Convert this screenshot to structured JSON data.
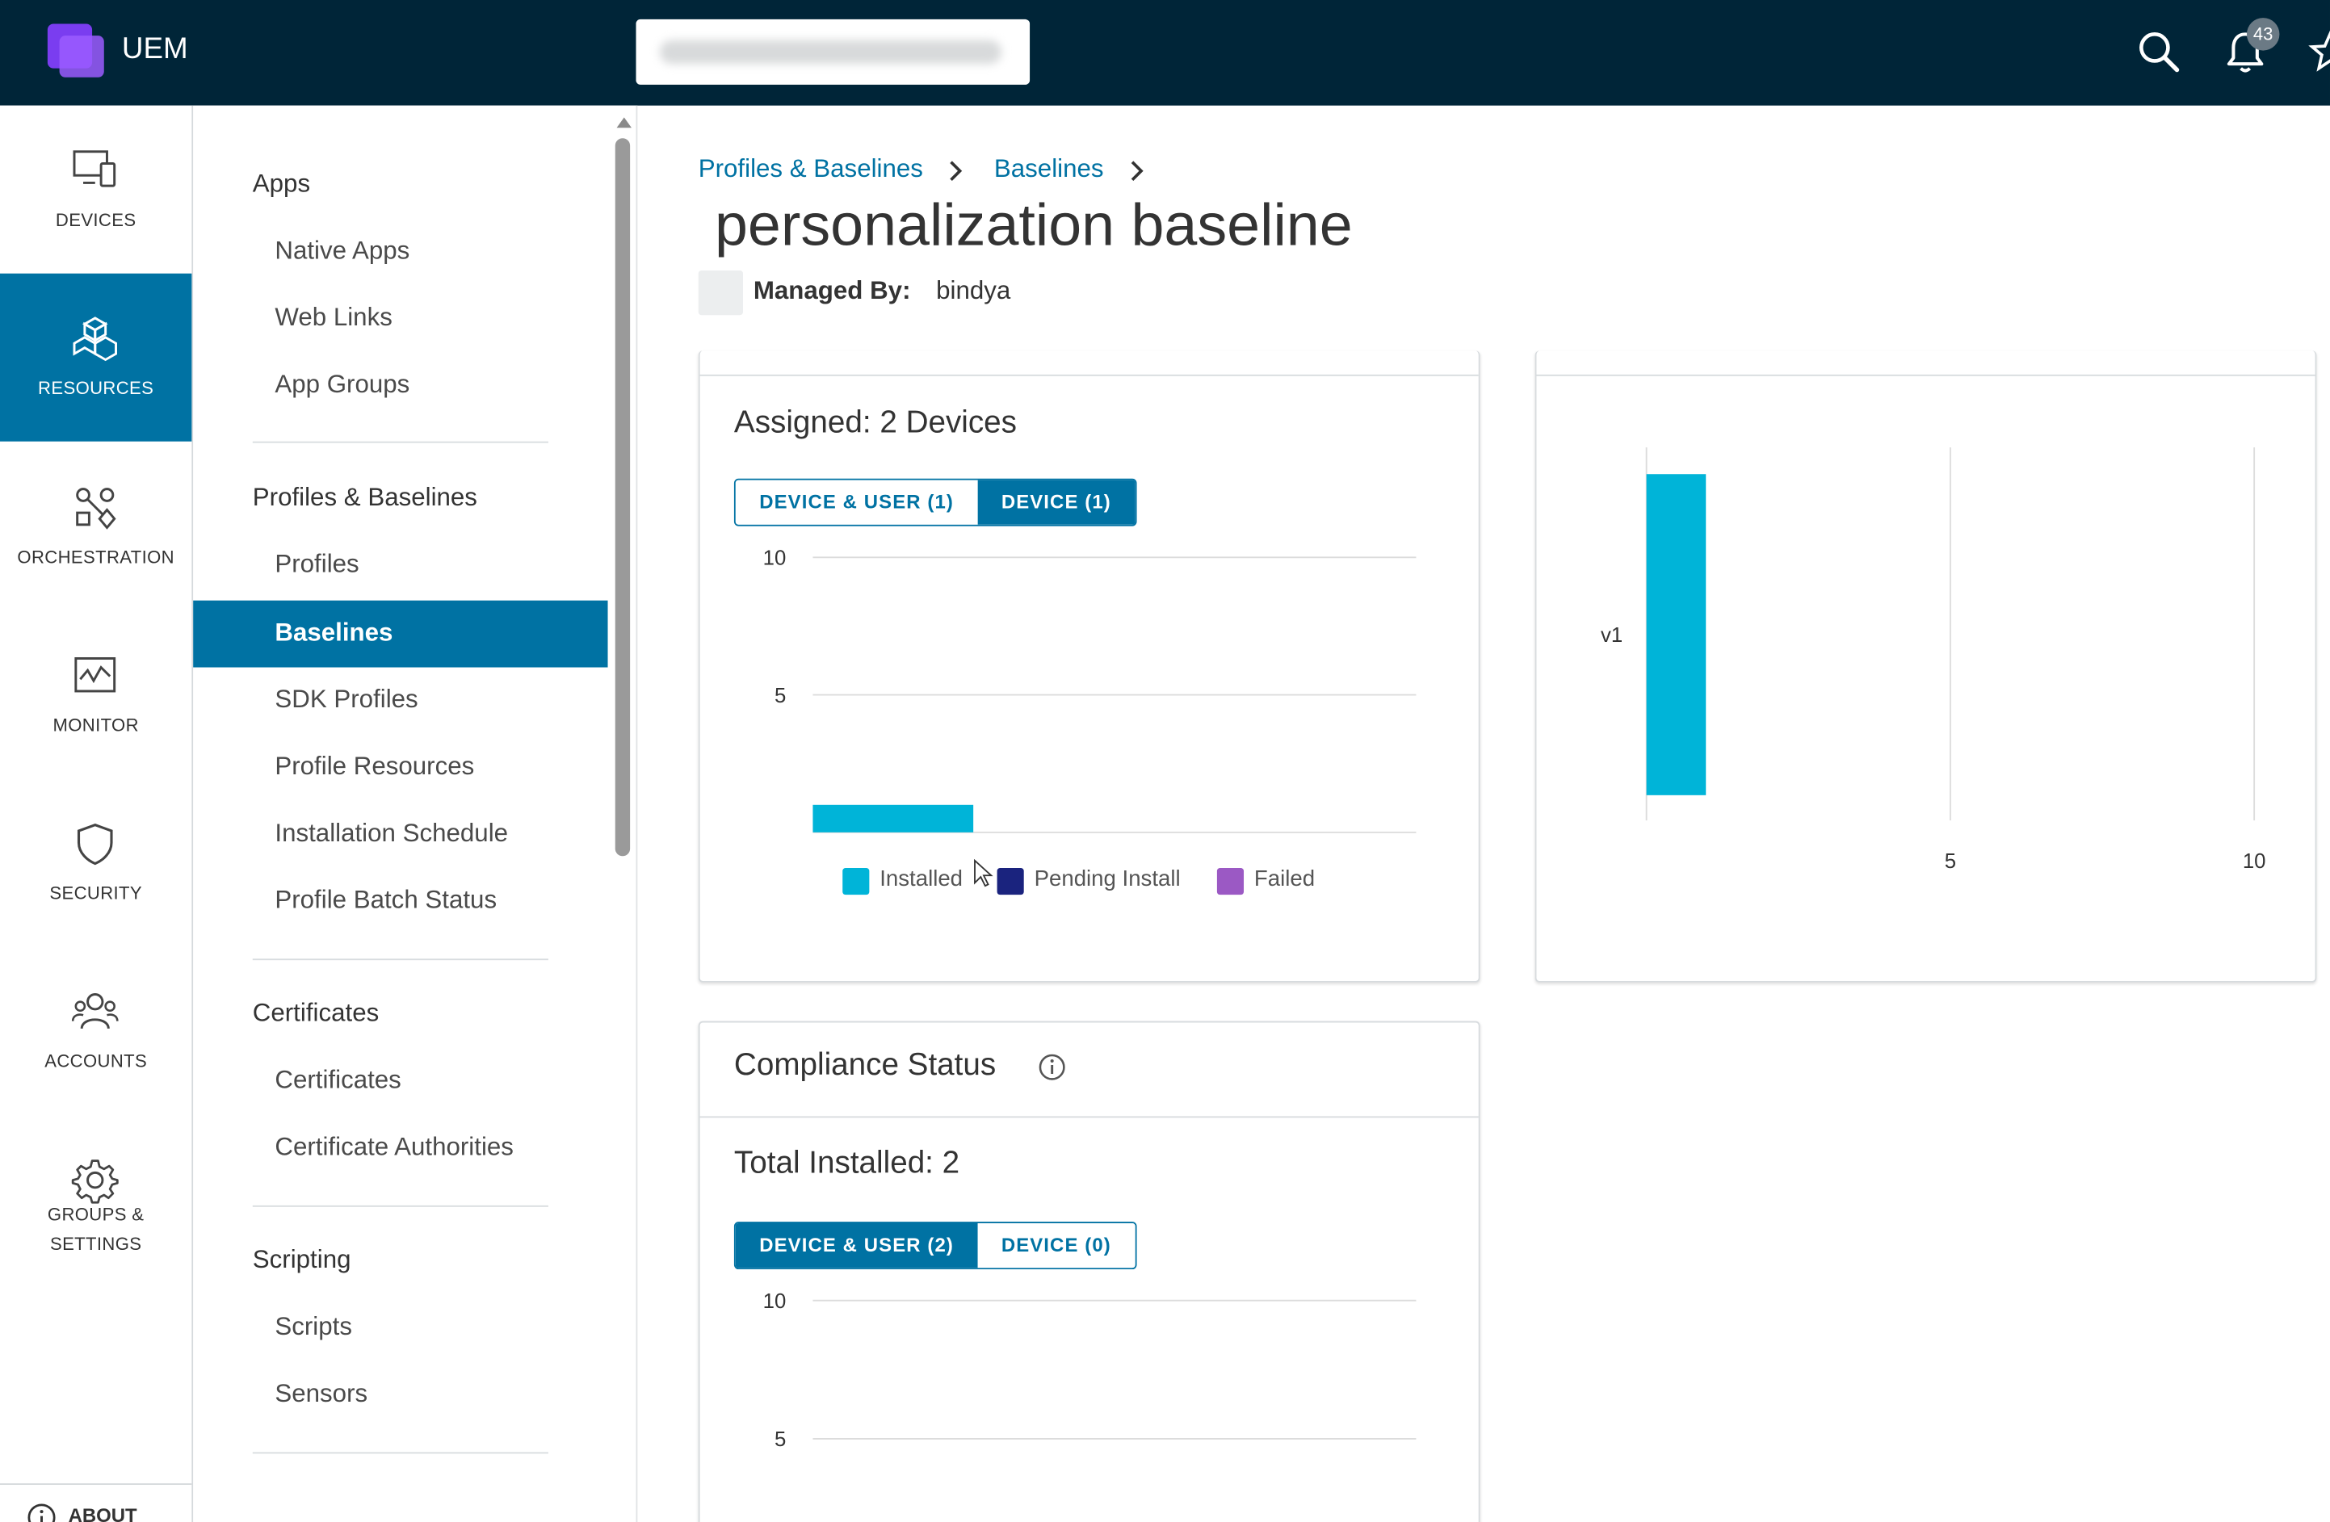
{
  "app": {
    "name": "UEM",
    "notification_count": "43"
  },
  "left_nav": {
    "items": [
      {
        "label": "DEVICES"
      },
      {
        "label": "RESOURCES"
      },
      {
        "label": "ORCHESTRATION"
      },
      {
        "label": "MONITOR"
      },
      {
        "label": "SECURITY"
      },
      {
        "label": "ACCOUNTS"
      },
      {
        "label": "GROUPS &",
        "label2": "SETTINGS"
      }
    ],
    "about": "ABOUT"
  },
  "sub_nav": {
    "sections": [
      {
        "title": "Apps",
        "items": [
          "Native Apps",
          "Web Links",
          "App Groups"
        ]
      },
      {
        "title": "Profiles & Baselines",
        "items": [
          "Profiles",
          "Baselines",
          "SDK Profiles",
          "Profile Resources",
          "Installation Schedule",
          "Profile Batch Status"
        ]
      },
      {
        "title": "Certificates",
        "items": [
          "Certificates",
          "Certificate Authorities"
        ]
      },
      {
        "title": "Scripting",
        "items": [
          "Scripts",
          "Sensors"
        ]
      }
    ]
  },
  "breadcrumb": {
    "first": "Profiles & Baselines",
    "second": "Baselines"
  },
  "page": {
    "title": "personalization baseline",
    "managed_by_label": "Managed By:",
    "managed_by_value": "bindya"
  },
  "assigned_card": {
    "heading": "Assigned: 2 Devices",
    "tabs": [
      "DEVICE & USER (1)",
      "DEVICE (1)"
    ],
    "active_tab": "DEVICE (1)",
    "yticks": [
      "10",
      "5"
    ],
    "legend": [
      {
        "label": "Installed",
        "color": "#00b4d8"
      },
      {
        "label": "Pending Install",
        "color": "#1a237e"
      },
      {
        "label": "Failed",
        "color": "#9b59c4"
      }
    ]
  },
  "version_card": {
    "category": "v1",
    "xticks": [
      "5",
      "10"
    ]
  },
  "compliance_card": {
    "title": "Compliance Status",
    "heading": "Total Installed: 2",
    "tabs": [
      "DEVICE & USER (2)",
      "DEVICE (0)"
    ],
    "active_tab": "DEVICE & USER (2)",
    "yticks": [
      "10",
      "5"
    ]
  },
  "chart_data": [
    {
      "type": "bar",
      "title": "Assigned: 2 Devices",
      "categories": [
        ""
      ],
      "series": [
        {
          "name": "Installed",
          "values": [
            1
          ]
        },
        {
          "name": "Pending Install",
          "values": [
            0
          ]
        },
        {
          "name": "Failed",
          "values": [
            0
          ]
        }
      ],
      "ylim": [
        0,
        10
      ],
      "yticks": [
        5,
        10
      ]
    },
    {
      "type": "bar",
      "orientation": "horizontal",
      "categories": [
        "v1"
      ],
      "values": [
        2
      ],
      "xlim": [
        0,
        10
      ],
      "xticks": [
        5,
        10
      ]
    }
  ]
}
